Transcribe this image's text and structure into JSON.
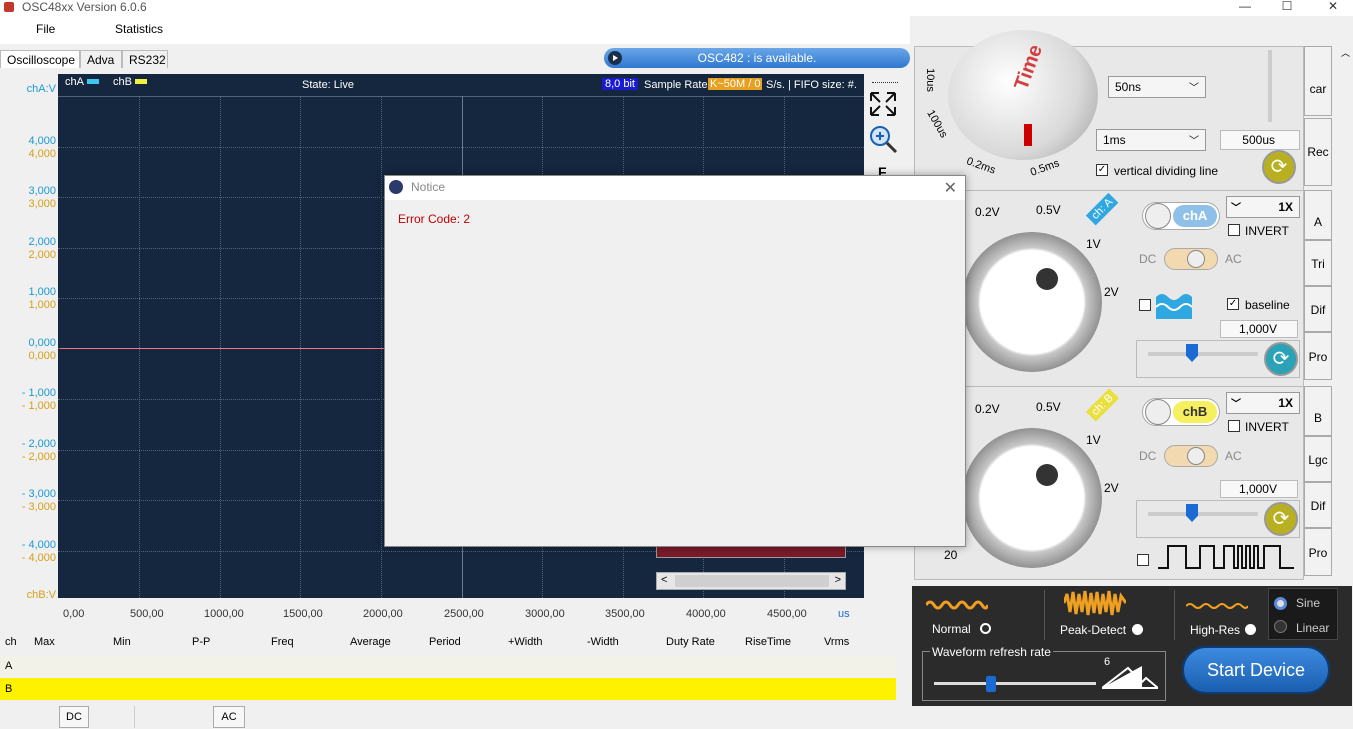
{
  "window": {
    "title": "OSC48xx  Version 6.0.6",
    "minimize": "—",
    "maximize": "☐",
    "close": "✕"
  },
  "menu": {
    "file": "File",
    "statistics": "Statistics"
  },
  "tabs": [
    "Oscilloscope",
    "Adva",
    "RS232"
  ],
  "banner": "OSC482 :  is available.",
  "scope": {
    "cha_label": "chA",
    "chb_label": "chB",
    "state": "State: Live",
    "bits": "8,0 bit",
    "sample_rate_label": "Sample Rate",
    "sample_rate_value": "K~50M / 0",
    "fifo": "S/s. | FIFO size: #.",
    "y_cha_unit": "chA:V",
    "y_chb_unit": "chB:V",
    "y_labels_a": [
      "4,000",
      "3,000",
      "2,000",
      "1,000",
      "0,000",
      "- 1,000",
      "- 2,000",
      "- 3,000",
      "- 4,000"
    ],
    "y_labels_b": [
      "4,000",
      "3,000",
      "2,000",
      "1,000",
      "0,000",
      "- 1,000",
      "- 2,000",
      "- 3,000",
      "- 4,000"
    ],
    "x_labels": [
      "0,00",
      "500,00",
      "1000,00",
      "1500,00",
      "2000,00",
      "2500,00",
      "3000,00",
      "3500,00",
      "4000,00",
      "4500,00"
    ],
    "x_unit": "us",
    "letter_f": "F"
  },
  "stats": {
    "headers": [
      "ch",
      "Max",
      "Min",
      "P-P",
      "Freq",
      "Average",
      "Period",
      "+Width",
      "-Width",
      "Duty Rate",
      "RiseTime",
      "Vrms"
    ],
    "rows": [
      "A",
      "B"
    ]
  },
  "bottom_buttons": [
    "DC",
    "AC"
  ],
  "time_panel": {
    "dial_title": "Time",
    "dial_labels": [
      "10us",
      "100us",
      "0.2ms",
      "0.5ms"
    ],
    "select_1": "50ns",
    "select_2": "1ms",
    "field": "500us",
    "vertical_line": "vertical dividing line",
    "side_tabs": [
      "car",
      "Rec"
    ]
  },
  "cha_panel": {
    "tag": "ch: A",
    "dial_labels": [
      "0.2V",
      "0.5V",
      "1V",
      "2V"
    ],
    "toggle": "chA",
    "probe": "1X",
    "invert": "INVERT",
    "dc": "DC",
    "ac": "AC",
    "baseline": "baseline",
    "value": "1,000V",
    "side_tabs": [
      "A",
      "Tri",
      "Dif",
      "Pro"
    ]
  },
  "chb_panel": {
    "tag": "ch: B",
    "dial_labels": [
      "0.2V",
      "0.5V",
      "1V",
      "2V",
      "20"
    ],
    "toggle": "chB",
    "probe": "1X",
    "invert": "INVERT",
    "dc": "DC",
    "ac": "AC",
    "value": "1,000V",
    "side_tabs": [
      "B",
      "Lgc",
      "Dif",
      "Pro"
    ]
  },
  "modes": {
    "normal": "Normal",
    "peak": "Peak-Detect",
    "highres": "High-Res",
    "sine": "Sine",
    "linear": "Linear"
  },
  "refresh": {
    "label": "Waveform refresh rate",
    "value": "6",
    "level": 0.35
  },
  "start_button": "Start Device",
  "dialog": {
    "title": "Notice",
    "message": "Error Code: 2",
    "close": "✕"
  }
}
